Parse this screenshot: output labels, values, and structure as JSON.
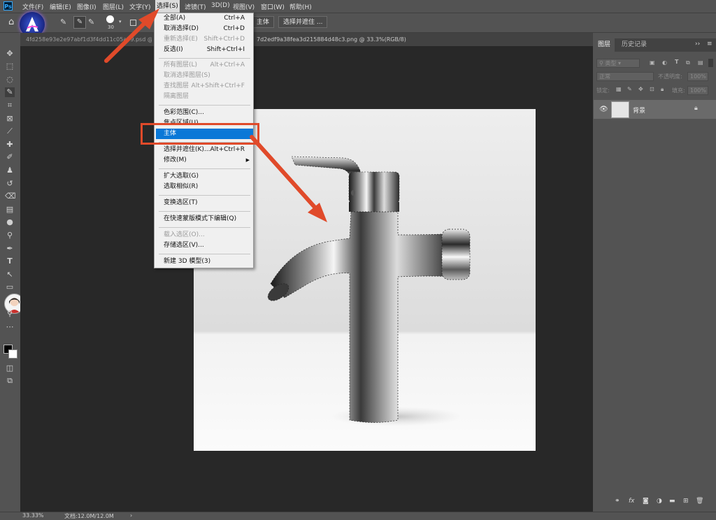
{
  "menubar": {
    "items": [
      "文件(F)",
      "编辑(E)",
      "图像(I)",
      "图层(L)",
      "文字(Y)",
      "选择(S)",
      "滤镜(T)",
      "3D(D)",
      "视图(V)",
      "窗口(W)",
      "帮助(H)"
    ],
    "active_index": 5
  },
  "options_bar": {
    "brush_size": "30",
    "subject_button": "主体",
    "select_mask_button": "选择并遮住 ..."
  },
  "tabs": {
    "tab1": "4fd258e93e2e97abf1d3f4dd11c05a79.psd @ 2",
    "tab2": "7d2edf9a38fea3d215884d48c3.png @ 33.3%(RGB/8)"
  },
  "select_menu": {
    "items": [
      {
        "label": "全部(A)",
        "shortcut": "Ctrl+A",
        "disabled": false
      },
      {
        "label": "取消选择(D)",
        "shortcut": "Ctrl+D",
        "disabled": false
      },
      {
        "label": "重新选择(E)",
        "shortcut": "Shift+Ctrl+D",
        "disabled": true
      },
      {
        "label": "反选(I)",
        "shortcut": "Shift+Ctrl+I",
        "disabled": false
      },
      {
        "label": "所有图层(L)",
        "shortcut": "Alt+Ctrl+A",
        "disabled": true
      },
      {
        "label": "取消选择图层(S)",
        "shortcut": "",
        "disabled": true
      },
      {
        "label": "查找图层",
        "shortcut": "Alt+Shift+Ctrl+F",
        "disabled": true
      },
      {
        "label": "隔离图层",
        "shortcut": "",
        "disabled": true
      },
      {
        "label": "色彩范围(C)...",
        "shortcut": "",
        "disabled": false
      },
      {
        "label": "焦点区域(U)...",
        "shortcut": "",
        "disabled": false
      },
      {
        "label": "主体",
        "shortcut": "",
        "disabled": false,
        "highlighted": true
      },
      {
        "label": "选择并遮住(K)...",
        "shortcut": "Alt+Ctrl+R",
        "disabled": false
      },
      {
        "label": "修改(M)",
        "shortcut": "",
        "disabled": false,
        "submenu": true
      },
      {
        "label": "扩大选取(G)",
        "shortcut": "",
        "disabled": false
      },
      {
        "label": "选取相似(R)",
        "shortcut": "",
        "disabled": false
      },
      {
        "label": "变换选区(T)",
        "shortcut": "",
        "disabled": false
      },
      {
        "label": "在快速蒙版模式下编辑(Q)",
        "shortcut": "",
        "disabled": false
      },
      {
        "label": "载入选区(O)...",
        "shortcut": "",
        "disabled": true
      },
      {
        "label": "存储选区(V)...",
        "shortcut": "",
        "disabled": false
      },
      {
        "label": "新建 3D 模型(3)",
        "shortcut": "",
        "disabled": false
      }
    ]
  },
  "layers_panel": {
    "tab_layers": "图层",
    "tab_history": "历史记录",
    "kind_filter": "类型",
    "blend_mode": "正常",
    "opacity_label": "不透明度:",
    "opacity_value": "100%",
    "lock_label": "锁定:",
    "fill_label": "填充:",
    "fill_value": "100%",
    "layer_name": "背景"
  },
  "status_bar": {
    "zoom": "33.33%",
    "doc_size": "文档:12.0M/12.0M"
  },
  "colors": {
    "accent": "#0a78d7",
    "annotation": "#e04a2a"
  }
}
